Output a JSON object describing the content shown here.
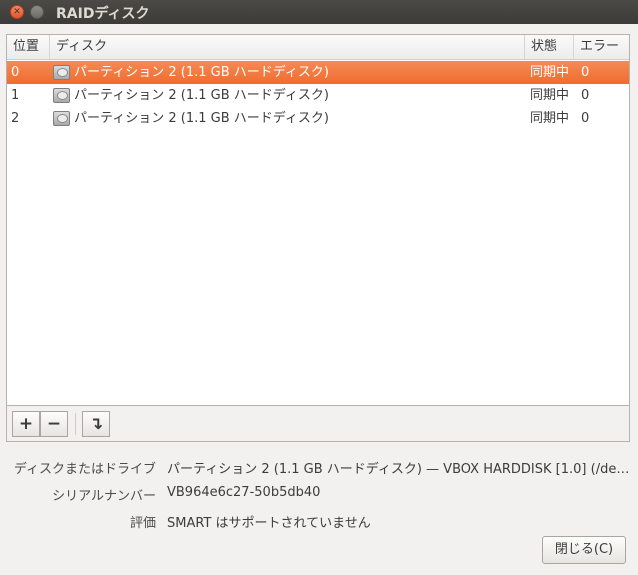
{
  "window": {
    "title": "RAIDディスク"
  },
  "table": {
    "headers": {
      "position": "位置",
      "disk": "ディスク",
      "state": "状態",
      "errors": "エラー"
    },
    "rows": [
      {
        "position": "0",
        "disk": "パーティション 2 (1.1 GB ハードディスク)",
        "state": "同期中",
        "errors": "0",
        "selected": true
      },
      {
        "position": "1",
        "disk": "パーティション 2 (1.1 GB ハードディスク)",
        "state": "同期中",
        "errors": "0",
        "selected": false
      },
      {
        "position": "2",
        "disk": "パーティション 2 (1.1 GB ハードディスク)",
        "state": "同期中",
        "errors": "0",
        "selected": false
      }
    ]
  },
  "toolbar": {
    "add": "+",
    "remove": "−",
    "replace": "↴"
  },
  "details": {
    "drive_label": "ディスクまたはドライブ",
    "drive_value": "パーティション 2 (1.1 GB ハードディスク) — VBOX HARDDISK [1.0] (/de…",
    "serial_label": "シリアルナンバー",
    "serial_value": "VB964e6c27-50b5db40",
    "assessment_label": "評価",
    "assessment_value": "SMART はサポートされていません"
  },
  "buttons": {
    "close": "閉じる(C)"
  },
  "colors": {
    "selection": "#ef6c2e",
    "titlebar": "#3c3b37"
  }
}
